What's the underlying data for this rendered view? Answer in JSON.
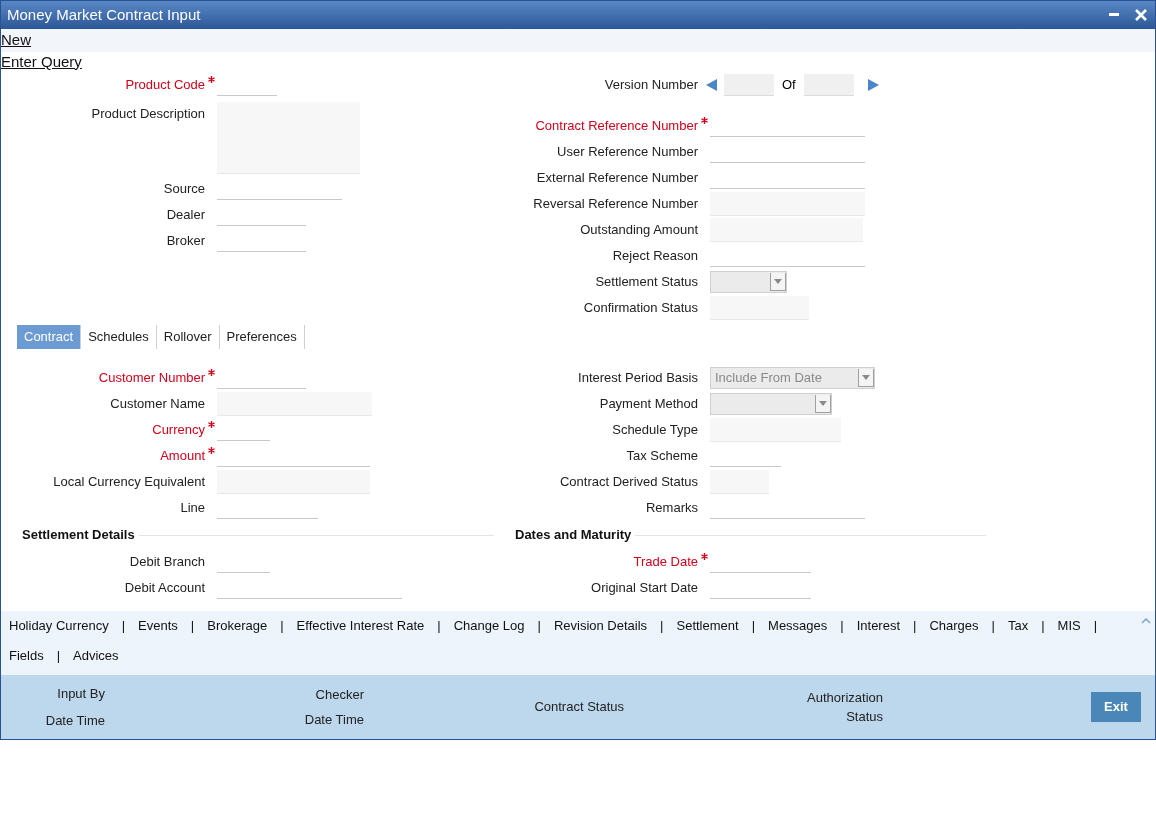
{
  "window": {
    "title": "Money Market Contract Input"
  },
  "toolbar": [
    {
      "label": "New"
    },
    {
      "label": "Enter Query"
    }
  ],
  "header": {
    "left": [
      {
        "label": "Product Code",
        "required": true,
        "kind": "line"
      },
      {
        "label": "Product Description",
        "required": false,
        "kind": "textarea"
      },
      {
        "label": "Source",
        "required": false,
        "kind": "line"
      },
      {
        "label": "Dealer",
        "required": false,
        "kind": "line"
      },
      {
        "label": "Broker",
        "required": false,
        "kind": "line"
      }
    ],
    "version": {
      "label": "Version Number",
      "of": "Of"
    },
    "right": [
      {
        "label": "Contract Reference Number",
        "required": true,
        "kind": "line"
      },
      {
        "label": "User Reference Number",
        "required": false,
        "kind": "line"
      },
      {
        "label": "External Reference Number",
        "required": false,
        "kind": "line"
      },
      {
        "label": "Reversal Reference Number",
        "required": false,
        "kind": "readonly"
      },
      {
        "label": "Outstanding Amount",
        "required": false,
        "kind": "readonly"
      },
      {
        "label": "Reject Reason",
        "required": false,
        "kind": "line"
      },
      {
        "label": "Settlement Status",
        "required": false,
        "kind": "select"
      },
      {
        "label": "Confirmation Status",
        "required": false,
        "kind": "readonly"
      }
    ]
  },
  "tabs": [
    {
      "label": "Contract",
      "selected": true
    },
    {
      "label": "Schedules",
      "selected": false
    },
    {
      "label": "Rollover",
      "selected": false
    },
    {
      "label": "Preferences",
      "selected": false
    }
  ],
  "contract": {
    "left": [
      {
        "label": "Customer Number",
        "required": true,
        "kind": "line"
      },
      {
        "label": "Customer Name",
        "required": false,
        "kind": "readonly"
      },
      {
        "label": "Currency",
        "required": true,
        "kind": "line"
      },
      {
        "label": "Amount",
        "required": true,
        "kind": "line"
      },
      {
        "label": "Local Currency Equivalent",
        "required": false,
        "kind": "readonly"
      },
      {
        "label": "Line",
        "required": false,
        "kind": "line"
      }
    ],
    "right": [
      {
        "label": "Interest Period Basis",
        "required": false,
        "kind": "select",
        "value": "Include From Date"
      },
      {
        "label": "Payment Method",
        "required": false,
        "kind": "select"
      },
      {
        "label": "Schedule Type",
        "required": false,
        "kind": "readonly"
      },
      {
        "label": "Tax Scheme",
        "required": false,
        "kind": "line"
      },
      {
        "label": "Contract Derived Status",
        "required": false,
        "kind": "readonly"
      },
      {
        "label": "Remarks",
        "required": false,
        "kind": "line"
      }
    ]
  },
  "sections": [
    {
      "title": "Settlement Details",
      "fields": [
        {
          "label": "Debit Branch",
          "required": false,
          "kind": "line"
        },
        {
          "label": "Debit Account",
          "required": false,
          "kind": "line"
        }
      ]
    },
    {
      "title": "Dates and Maturity",
      "fields": [
        {
          "label": "Trade Date",
          "required": true,
          "kind": "line"
        },
        {
          "label": "Original Start Date",
          "required": false,
          "kind": "line"
        }
      ]
    }
  ],
  "links": [
    [
      {
        "label": "Holiday Currency",
        "sep": "|"
      },
      {
        "label": "Events",
        "sep": "|"
      },
      {
        "label": "Brokerage",
        "sep": "|"
      },
      {
        "label": "Effective Interest Rate",
        "sep": "|"
      },
      {
        "label": "Change Log",
        "sep": "|"
      },
      {
        "label": "Revision Details",
        "sep": "|"
      },
      {
        "label": "Settlement",
        "sep": "|"
      },
      {
        "label": "Messages",
        "sep": "|"
      },
      {
        "label": "Interest",
        "sep": "|"
      },
      {
        "label": "Charges",
        "sep": "|"
      },
      {
        "label": "Tax",
        "sep": "|"
      },
      {
        "label": "MIS",
        "sep": "|"
      }
    ],
    [
      {
        "label": "Fields",
        "sep": "|"
      },
      {
        "label": "Advices"
      }
    ]
  ],
  "footer": {
    "groups": [
      [
        "Input By",
        "Date Time"
      ],
      [
        "Checker",
        "Date Time"
      ],
      [
        "Contract Status"
      ],
      [
        "Authorization Status"
      ]
    ],
    "exit": "Exit"
  }
}
